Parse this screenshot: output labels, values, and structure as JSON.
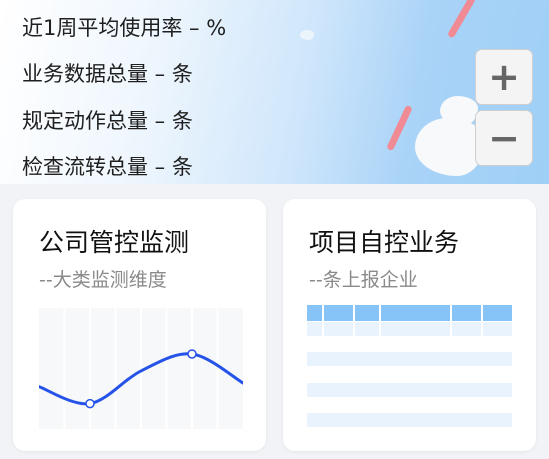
{
  "stats": {
    "usage_rate": "近1周平均使用率 – %",
    "business_data": "业务数据总量 – 条",
    "actions": "规定动作总量 – 条",
    "inspection": "检查流转总量 – 条"
  },
  "map_controls": {
    "zoom_in": "+",
    "zoom_out": "−"
  },
  "cards": {
    "monitoring": {
      "title": "公司管控监测",
      "subtitle": "--大类监测维度"
    },
    "projects": {
      "title": "项目自控业务",
      "subtitle": "--条上报企业"
    }
  },
  "chart_data": {
    "type": "line",
    "smooth": true,
    "x": [
      0,
      1,
      2,
      3,
      4
    ],
    "values": [
      0.35,
      0.21,
      0.48,
      0.62,
      0.38
    ],
    "markers_at": [
      1,
      3
    ],
    "grid": true,
    "color": "#2553e8",
    "title": "",
    "xlabel": "",
    "ylabel": ""
  },
  "colors": {
    "table_header": "#86c3f7",
    "table_row": "#e8f3fd",
    "route": "#f08a95",
    "map_water": "#a9d3f7"
  }
}
